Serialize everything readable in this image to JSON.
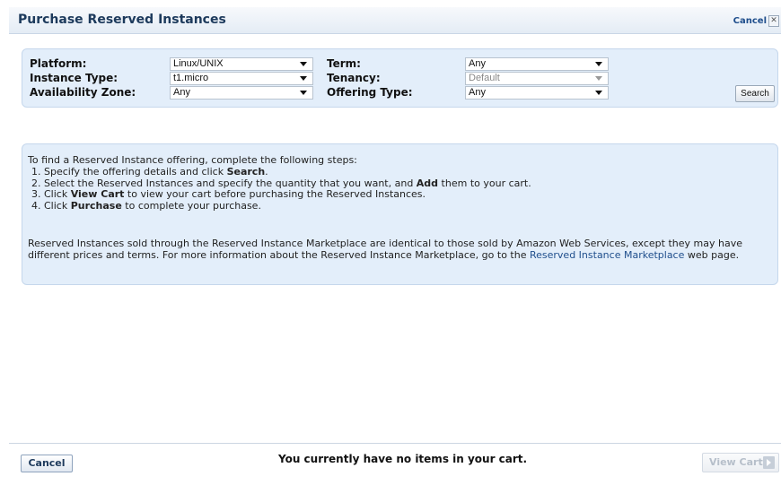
{
  "header": {
    "title": "Purchase Reserved Instances",
    "cancel_label": "Cancel",
    "close_glyph": "✕"
  },
  "search": {
    "platform_label": "Platform:",
    "platform_value": "Linux/UNIX",
    "instance_type_label": "Instance Type:",
    "instance_type_value": "t1.micro",
    "availability_zone_label": "Availability Zone:",
    "availability_zone_value": "Any",
    "term_label": "Term:",
    "term_value": "Any",
    "tenancy_label": "Tenancy:",
    "tenancy_value": "Default",
    "offering_type_label": "Offering Type:",
    "offering_type_value": "Any",
    "search_button": "Search"
  },
  "info": {
    "intro": "To find a Reserved Instance offering, complete the following steps:",
    "step1_pre": "1. Specify the offering details and click ",
    "step1_bold": "Search",
    "step1_post": ".",
    "step2_pre": "2. Select the Reserved Instances and specify the quantity that you want, and ",
    "step2_bold": "Add",
    "step2_post": " them to your cart.",
    "step3_pre": "3. Click ",
    "step3_bold": "View Cart",
    "step3_post": " to view your cart before purchasing the Reserved Instances.",
    "step4_pre": "4. Click ",
    "step4_bold": "Purchase",
    "step4_post": " to complete your purchase.",
    "market_text": "Reserved Instances sold through the Reserved Instance Marketplace are identical to those sold by Amazon Web Services, except they may have different prices and terms. For more information about the Reserved Instance Marketplace, go to the ",
    "market_link": "Reserved Instance Marketplace",
    "market_post": " web page."
  },
  "footer": {
    "cancel_button": "Cancel",
    "cart_message": "You currently have no items in your cart.",
    "view_cart_button": "View Cart"
  },
  "colors": {
    "panel_bg": "#e3eefa",
    "link": "#1f4e8c",
    "title": "#1d3a5c"
  }
}
